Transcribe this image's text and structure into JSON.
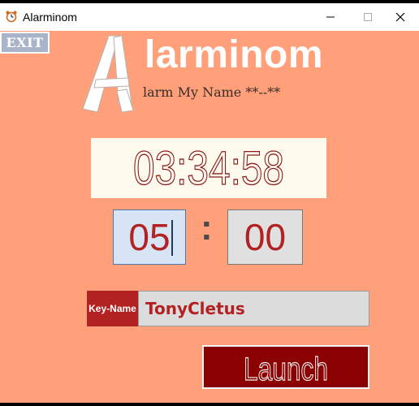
{
  "window": {
    "title": "Alarminom",
    "controls": {
      "minimize": "minimize-icon",
      "maximize": "maximize-icon",
      "close": "close-icon"
    }
  },
  "toolbar": {
    "exit_label": "EXIT"
  },
  "logo": {
    "big_letter": "A",
    "word": "larminom",
    "tagline": "larm My Name **--**"
  },
  "clock": {
    "time": "03:34:58"
  },
  "alarm": {
    "hours": "05",
    "separator": ":",
    "minutes": "00"
  },
  "key_name": {
    "label": "Key-Name",
    "value": "TonyCletus"
  },
  "launch": {
    "label": "Launch"
  },
  "colors": {
    "background": "#ffa07a",
    "accent_red": "#b22222",
    "launch_bg": "#8b0000",
    "clock_bg": "#fffaee",
    "exit_bg": "#a9b4c8"
  }
}
